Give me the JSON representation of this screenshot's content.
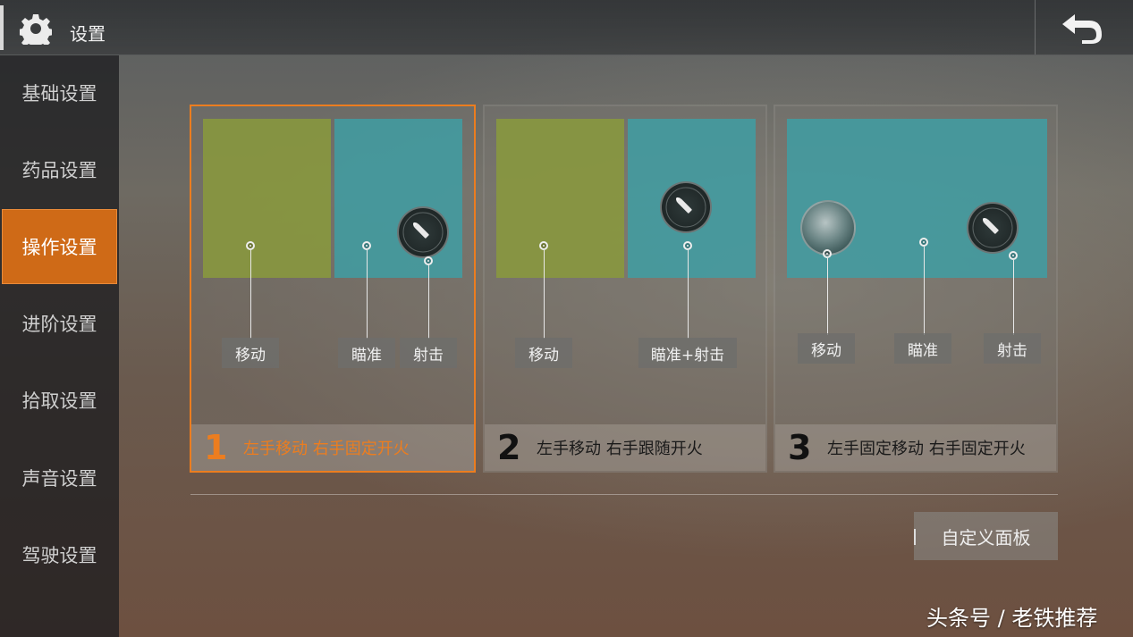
{
  "header": {
    "title": "设置"
  },
  "sidebar": {
    "items": [
      {
        "label": "基础设置"
      },
      {
        "label": "药品设置"
      },
      {
        "label": "操作设置"
      },
      {
        "label": "进阶设置"
      },
      {
        "label": "拾取设置"
      },
      {
        "label": "声音设置"
      },
      {
        "label": "驾驶设置"
      }
    ],
    "active_index": 2
  },
  "modes": [
    {
      "number": "1",
      "text": "左手移动 右手固定开火",
      "selected": true,
      "labels": [
        "移动",
        "瞄准",
        "射击"
      ]
    },
    {
      "number": "2",
      "text": "左手移动 右手跟随开火",
      "selected": false,
      "labels": [
        "移动",
        "瞄准+射击"
      ]
    },
    {
      "number": "3",
      "text": "左手固定移动 右手固定开火",
      "selected": false,
      "labels": [
        "移动",
        "瞄准",
        "射击"
      ]
    }
  ],
  "custom_panel_label": "自定义面板",
  "watermark": "头条号 / 老铁推荐",
  "colors": {
    "accent": "#ec7d1f",
    "sidebar_active": "#cf6a17",
    "move_zone": "#8a9a3c",
    "aim_zone": "#3f9ea3"
  },
  "icons": {
    "settings": "gear-icon",
    "back": "return-arrow-icon",
    "fire": "bullet-icon",
    "move": "joystick-icon"
  }
}
